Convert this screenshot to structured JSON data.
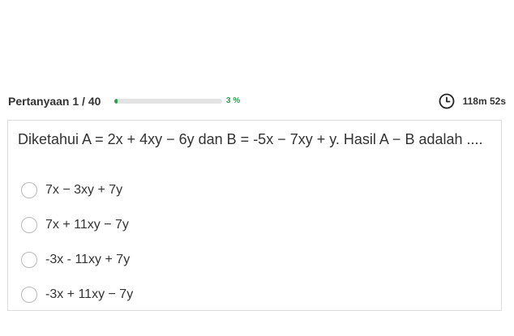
{
  "header": {
    "question_counter": "Pertanyaan 1 / 40",
    "progress_percent_label": "3 %",
    "progress_value": 0.03,
    "timer_icon": "clock-icon",
    "timer_text": "118m 52s",
    "accent_color": "#2e9e4f"
  },
  "question": {
    "text": "Diketahui A = 2x + 4xy − 6y dan B = -5x − 7xy + y. Hasil A − B adalah ....",
    "options": [
      {
        "label": "7x − 3xy + 7y"
      },
      {
        "label": "7x + 11xy − 7y"
      },
      {
        "label": "-3x - 11xy + 7y"
      },
      {
        "label": "-3x + 11xy − 7y"
      }
    ]
  }
}
